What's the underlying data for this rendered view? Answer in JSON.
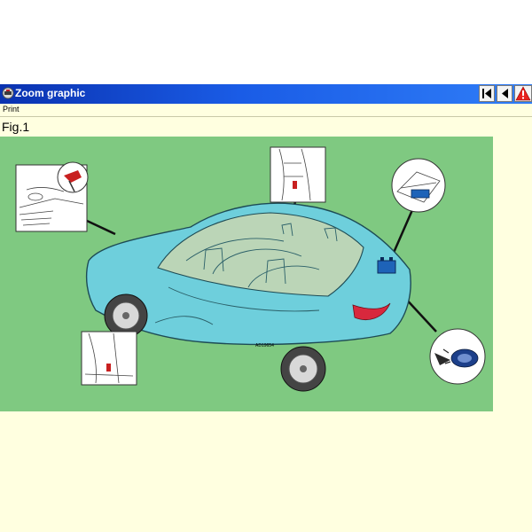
{
  "window": {
    "title": "Zoom graphic",
    "icon": "app-logo-icon",
    "toolbar_icons": [
      "first-page-icon",
      "previous-page-icon",
      "warning-icon"
    ]
  },
  "menu": {
    "print_label": "Print"
  },
  "figure": {
    "label": "Fig.1",
    "part_number": "AD19654",
    "background_color": "#7fc981",
    "car_color": "#6ecfdc",
    "callouts": [
      "detail-front-grille-release",
      "detail-door-pillar",
      "detail-trunk-battery",
      "detail-rocker-panel",
      "detail-remote-key"
    ]
  }
}
